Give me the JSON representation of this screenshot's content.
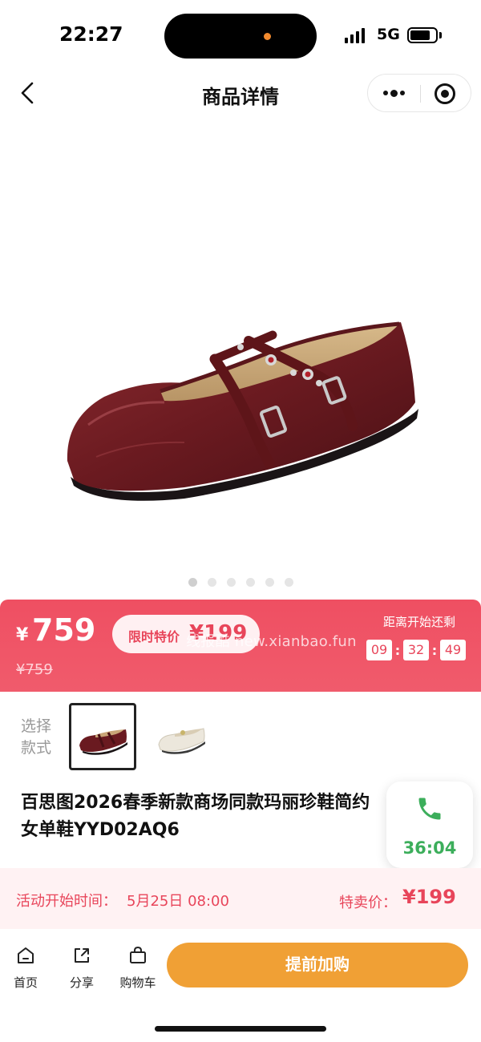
{
  "status_bar": {
    "time": "22:27",
    "network": "5G",
    "battery_level": 0.8
  },
  "nav": {
    "title": "商品详情",
    "back_icon": "chevron-left-icon",
    "more_icon": "more-dots-icon",
    "close_icon": "target-close-icon"
  },
  "gallery": {
    "image_icon": "red-mary-jane-flat-shoe",
    "slide_count": 6,
    "active_slide": 1
  },
  "price": {
    "currency": "¥",
    "current": "759",
    "original": "¥759",
    "promo_label": "限时特价",
    "promo_price": "¥199",
    "watermark": "线报酷 new.xianbao.fun",
    "countdown_label": "距离开始还剩",
    "countdown": [
      "09",
      "32",
      "49"
    ],
    "colors": {
      "banner": "#ef4f62",
      "accent": "#e8455a"
    }
  },
  "style_select": {
    "label": "选择款式",
    "options": [
      {
        "name": "burgundy",
        "selected": true
      },
      {
        "name": "white",
        "selected": false
      }
    ]
  },
  "product": {
    "title_line1": "百思图2026春季新款商场同款玛丽珍鞋简约",
    "title_line2": "女单鞋YYD02AQ6"
  },
  "call": {
    "icon": "phone-icon",
    "timer": "36:04",
    "color": "#3cae5b"
  },
  "activity": {
    "start_label": "活动开始时间：",
    "start_time": "5月25日 08:00",
    "special_label": "特卖价：",
    "special_price": "¥199"
  },
  "bottom_bar": {
    "tabs": [
      {
        "label": "首页",
        "icon": "home-icon"
      },
      {
        "label": "分享",
        "icon": "share-icon"
      },
      {
        "label": "购物车",
        "icon": "bag-icon"
      }
    ],
    "cta_label": "提前加购",
    "cta_color": "#f0a035"
  }
}
